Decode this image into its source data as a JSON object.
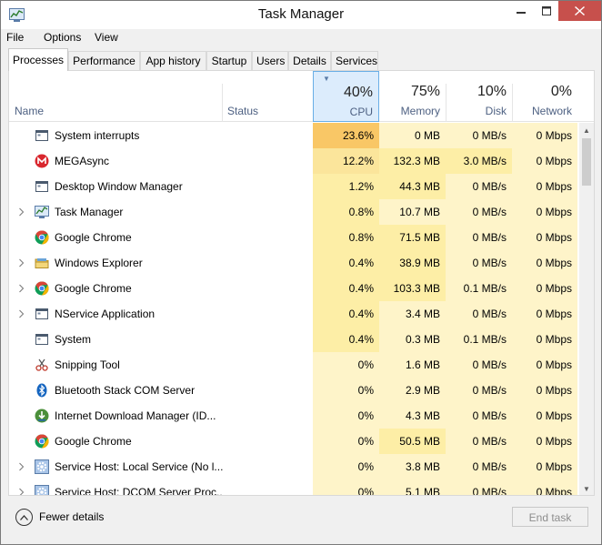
{
  "window": {
    "title": "Task Manager"
  },
  "menu": [
    "File",
    "Options",
    "View"
  ],
  "tabs": [
    "Processes",
    "Performance",
    "App history",
    "Startup",
    "Users",
    "Details",
    "Services"
  ],
  "active_tab": "Processes",
  "columns": {
    "name": "Name",
    "status": "Status",
    "cpu": {
      "pct": "40%",
      "label": "CPU"
    },
    "memory": {
      "pct": "75%",
      "label": "Memory"
    },
    "disk": {
      "pct": "10%",
      "label": "Disk"
    },
    "network": {
      "pct": "0%",
      "label": "Network"
    }
  },
  "sorted_column": "CPU",
  "processes": [
    {
      "name": "System interrupts",
      "icon": "system-window-icon",
      "expandable": false,
      "cpu": "23.6%",
      "memory": "0 MB",
      "disk": "0 MB/s",
      "network": "0 Mbps"
    },
    {
      "name": "MEGAsync",
      "icon": "megasync-icon",
      "expandable": false,
      "cpu": "12.2%",
      "memory": "132.3 MB",
      "disk": "3.0 MB/s",
      "network": "0 Mbps"
    },
    {
      "name": "Desktop Window Manager",
      "icon": "system-window-icon",
      "expandable": false,
      "cpu": "1.2%",
      "memory": "44.3 MB",
      "disk": "0 MB/s",
      "network": "0 Mbps"
    },
    {
      "name": "Task Manager",
      "icon": "task-manager-icon",
      "expandable": true,
      "cpu": "0.8%",
      "memory": "10.7 MB",
      "disk": "0 MB/s",
      "network": "0 Mbps"
    },
    {
      "name": "Google Chrome",
      "icon": "chrome-icon",
      "expandable": false,
      "cpu": "0.8%",
      "memory": "71.5 MB",
      "disk": "0 MB/s",
      "network": "0 Mbps"
    },
    {
      "name": "Windows Explorer",
      "icon": "folder-icon",
      "expandable": true,
      "cpu": "0.4%",
      "memory": "38.9 MB",
      "disk": "0 MB/s",
      "network": "0 Mbps"
    },
    {
      "name": "Google Chrome",
      "icon": "chrome-icon",
      "expandable": true,
      "cpu": "0.4%",
      "memory": "103.3 MB",
      "disk": "0.1 MB/s",
      "network": "0 Mbps"
    },
    {
      "name": "NService Application",
      "icon": "system-window-icon",
      "expandable": true,
      "cpu": "0.4%",
      "memory": "3.4 MB",
      "disk": "0 MB/s",
      "network": "0 Mbps"
    },
    {
      "name": "System",
      "icon": "system-window-icon",
      "expandable": false,
      "cpu": "0.4%",
      "memory": "0.3 MB",
      "disk": "0.1 MB/s",
      "network": "0 Mbps"
    },
    {
      "name": "Snipping Tool",
      "icon": "scissors-icon",
      "expandable": false,
      "cpu": "0%",
      "memory": "1.6 MB",
      "disk": "0 MB/s",
      "network": "0 Mbps"
    },
    {
      "name": "Bluetooth Stack COM Server",
      "icon": "bluetooth-icon",
      "expandable": false,
      "cpu": "0%",
      "memory": "2.9 MB",
      "disk": "0 MB/s",
      "network": "0 Mbps"
    },
    {
      "name": "Internet Download Manager (ID...",
      "icon": "download-manager-icon",
      "expandable": false,
      "cpu": "0%",
      "memory": "4.3 MB",
      "disk": "0 MB/s",
      "network": "0 Mbps"
    },
    {
      "name": "Google Chrome",
      "icon": "chrome-icon",
      "expandable": false,
      "cpu": "0%",
      "memory": "50.5 MB",
      "disk": "0 MB/s",
      "network": "0 Mbps"
    },
    {
      "name": "Service Host: Local Service (No l...",
      "icon": "gear-icon",
      "expandable": true,
      "cpu": "0%",
      "memory": "3.8 MB",
      "disk": "0 MB/s",
      "network": "0 Mbps"
    },
    {
      "name": "Service Host: DCOM Server Proc...",
      "icon": "gear-icon",
      "expandable": true,
      "cpu": "0%",
      "memory": "5.1 MB",
      "disk": "0 MB/s",
      "network": "0 Mbps"
    }
  ],
  "footer": {
    "fewer_details": "Fewer details",
    "end_task": "End task"
  },
  "colors": {
    "heat_cpu_high": "#f9c766",
    "heat_cpu_mid": "#fbe59b",
    "heat_light": "#fef4c9",
    "heat_medium": "#fdeea6",
    "sorted_header": "#dcecfc",
    "close_button": "#c7504c"
  }
}
